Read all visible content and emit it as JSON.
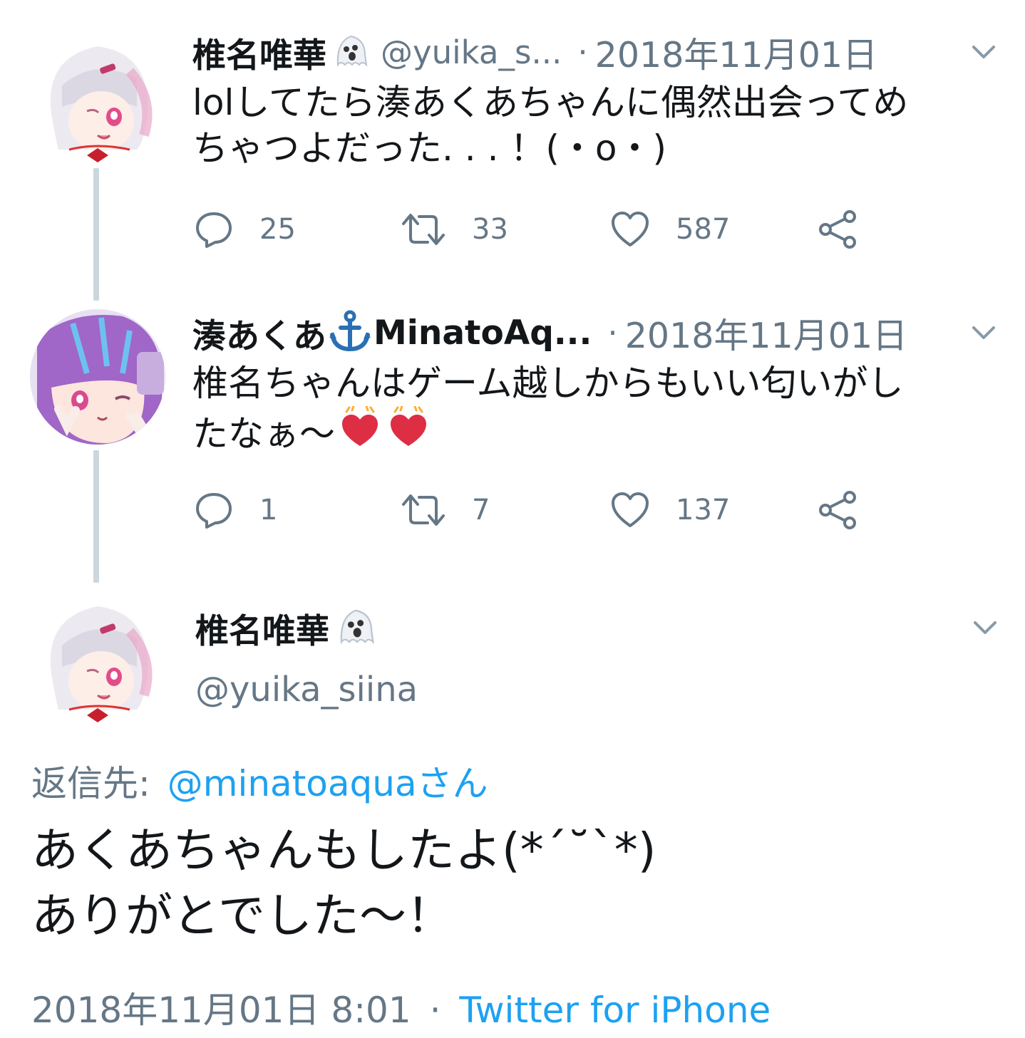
{
  "colors": {
    "link": "#1da1f2",
    "muted": "#657786",
    "text": "#14171a",
    "line": "#ccd6dd",
    "heart": "#e0245e"
  },
  "tweets": [
    {
      "name": "椎名唯華",
      "name_emoji": "ghost-emoji",
      "handle": "@yuika_s...",
      "sep": "·",
      "date": "2018年11月01日",
      "text_line1": "lolしてたら湊あくあちゃんに偶然出会ってめ",
      "text_line2": "ちゃつよだった. . . ！(・o・)",
      "actions": {
        "replies": "25",
        "retweets": "33",
        "likes": "587"
      }
    },
    {
      "name": "湊あくあ",
      "name_emoji": "anchor-emoji",
      "name_suffix": "MinatoAq...",
      "sep": "·",
      "date": "2018年11月01日",
      "text_line1": "椎名ちゃんはゲーム越しからもいい匂いがし",
      "text_line2": "たなぁ〜",
      "text_emojis": [
        "beating-heart-emoji",
        "beating-heart-emoji"
      ],
      "actions": {
        "replies": "1",
        "retweets": "7",
        "likes": "137"
      }
    }
  ],
  "main_tweet": {
    "name": "椎名唯華",
    "name_emoji": "ghost-emoji",
    "handle": "@yuika_siina",
    "reply_label": "返信先:",
    "reply_to": "@minatoaquaさん",
    "text_line1": "あくあちゃんもしたよ(*´˘`*)",
    "text_line2": "ありがとでした〜！",
    "timestamp": "2018年11月01日 8:01",
    "sep": "·",
    "source": "Twitter for iPhone"
  }
}
